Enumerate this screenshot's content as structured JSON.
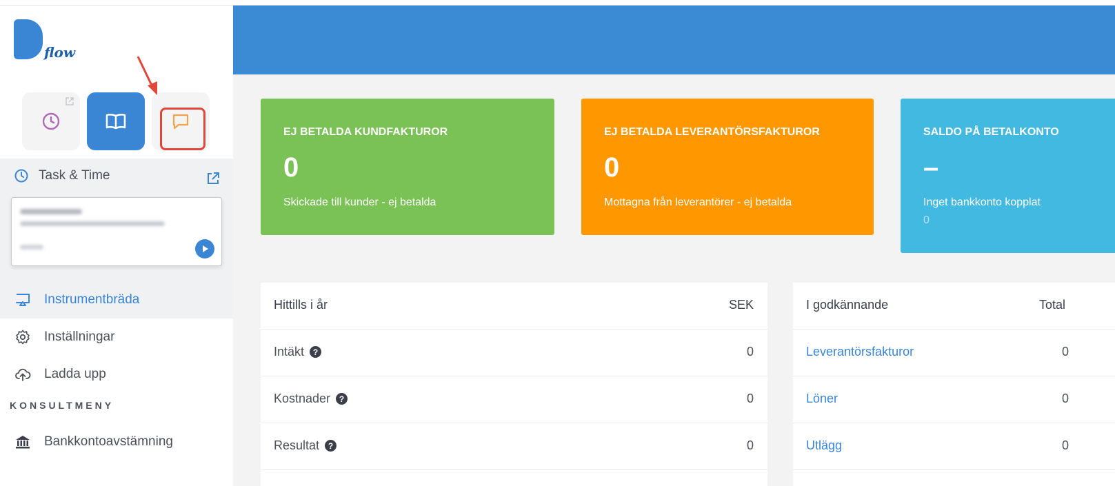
{
  "app": {
    "logo_text": "flow"
  },
  "sidebar": {
    "task": {
      "title": "Task & Time"
    },
    "items": [
      {
        "label": "Instrumentbräda",
        "active": true
      },
      {
        "label": "Inställningar"
      },
      {
        "label": "Ladda upp"
      }
    ],
    "section_label": "KONSULTMENY",
    "consult_items": [
      {
        "label": "Bankkontoavstämning"
      }
    ]
  },
  "stats": [
    {
      "title": "EJ BETALDA KUNDFAKTUROR",
      "value": "0",
      "subtitle": "Skickade till kunder - ej betalda",
      "color": "#7ac255"
    },
    {
      "title": "EJ BETALDA LEVERANTÖRSFAKTUROR",
      "value": "0",
      "subtitle": "Mottagna från leverantörer - ej betalda",
      "color": "#ff9800"
    },
    {
      "title": "SALDO PÅ BETALKONTO",
      "value": "–",
      "subtitle": "Inget bankkonto kopplat",
      "extra": "0",
      "color": "#42b9e1"
    }
  ],
  "ytd_table": {
    "header": {
      "label": "Hittills i år",
      "unit": "SEK"
    },
    "rows": [
      {
        "label": "Intäkt",
        "value": "0"
      },
      {
        "label": "Kostnader",
        "value": "0"
      },
      {
        "label": "Resultat",
        "value": "0"
      }
    ]
  },
  "approval_table": {
    "header": {
      "label": "I godkännande",
      "col_total": "Total"
    },
    "rows": [
      {
        "label": "Leverantörsfakturor",
        "total": "0"
      },
      {
        "label": "Löner",
        "total": "0"
      },
      {
        "label": "Utlägg",
        "total": "0"
      }
    ]
  },
  "colors": {
    "primary": "#3a86d4",
    "banner": "#3a8bd4",
    "highlight": "#e0473a"
  }
}
